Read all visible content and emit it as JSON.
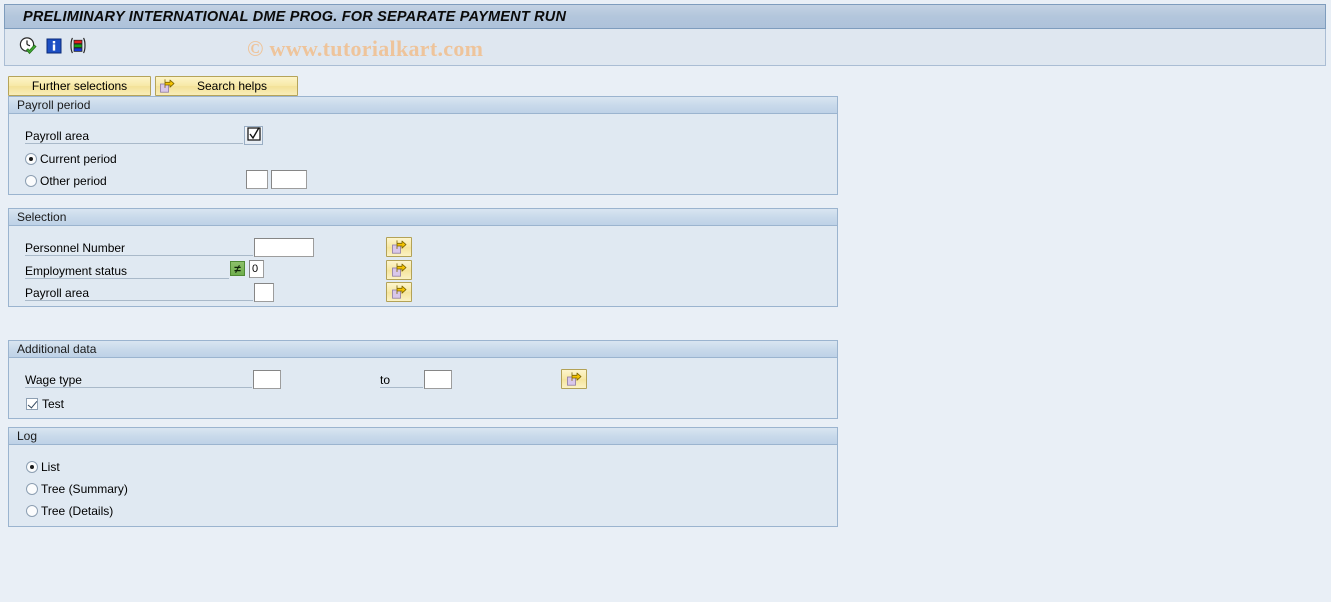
{
  "window": {
    "title": "PRELIMINARY INTERNATIONAL DME PROG. FOR SEPARATE PAYMENT RUN"
  },
  "watermark": "© www.tutorialkart.com",
  "toolbar": {
    "items": [
      {
        "name": "execute-clock-icon",
        "tooltip": "Execute"
      },
      {
        "name": "information-icon",
        "tooltip": "Information"
      },
      {
        "name": "variants-icon",
        "tooltip": "Get Variant"
      }
    ]
  },
  "buttons": {
    "further_selections": "Further selections",
    "search_helps": "Search helps"
  },
  "sections": {
    "payroll_period": {
      "title": "Payroll period",
      "payroll_area_label": "Payroll area",
      "payroll_area_icon": "checkbox-check-icon",
      "current_period": {
        "label": "Current period",
        "selected": true
      },
      "other_period": {
        "label": "Other period",
        "selected": false
      },
      "other_period_value_1": "",
      "other_period_value_2": ""
    },
    "selection": {
      "title": "Selection",
      "rows": [
        {
          "label": "Personnel Number",
          "value": "",
          "operator": "",
          "multi_select_icon": "multiple-selection-arrow-icon"
        },
        {
          "label": "Employment status",
          "value": "0",
          "operator": "≠",
          "multi_select_icon": "multiple-selection-arrow-icon"
        },
        {
          "label": "Payroll area",
          "value": "",
          "operator": "",
          "multi_select_icon": "multiple-selection-arrow-icon"
        }
      ]
    },
    "additional_data": {
      "title": "Additional data",
      "wage_type_label": "Wage type",
      "wage_type_from": "",
      "to_label": "to",
      "wage_type_to": "",
      "multi_select_icon": "multiple-selection-arrow-icon",
      "test": {
        "label": "Test",
        "checked": true
      }
    },
    "log": {
      "title": "Log",
      "options": [
        {
          "label": "List",
          "selected": true
        },
        {
          "label": "Tree (Summary)",
          "selected": false
        },
        {
          "label": "Tree (Details)",
          "selected": false
        }
      ]
    }
  },
  "colors": {
    "title_bar": "#b3c6dc",
    "page_background": "#e9eff6",
    "group_background": "#e0e9f2",
    "group_header": "#c8d9ea",
    "button_yellow": "#f7e9a8",
    "operator_green": "#6fae4c"
  }
}
